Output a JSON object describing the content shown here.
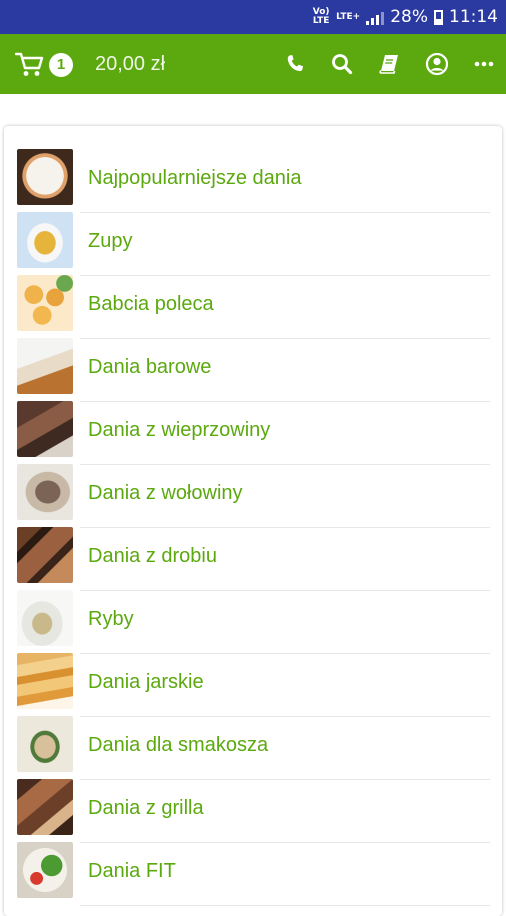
{
  "status_bar": {
    "volte": "Vo) LTE",
    "network": "LTE+",
    "battery": "28%",
    "battery_level": 0.28,
    "time": "11:14"
  },
  "header": {
    "cart_count": "1",
    "cart_total": "20,00 zł",
    "actions": [
      "phone-icon",
      "search-icon",
      "book-icon",
      "account-icon",
      "more-icon"
    ]
  },
  "colors": {
    "accent": "#5ba90f",
    "status_bar": "#2b3aa0"
  },
  "categories": [
    {
      "label": "Najpopularniejsze dania"
    },
    {
      "label": "Zupy"
    },
    {
      "label": "Babcia poleca"
    },
    {
      "label": "Dania barowe"
    },
    {
      "label": "Dania z wieprzowiny"
    },
    {
      "label": "Dania z wołowiny"
    },
    {
      "label": "Dania z drobiu"
    },
    {
      "label": "Ryby"
    },
    {
      "label": "Dania jarskie"
    },
    {
      "label": "Dania dla smakosza"
    },
    {
      "label": "Dania z grilla"
    },
    {
      "label": "Dania FIT"
    }
  ]
}
